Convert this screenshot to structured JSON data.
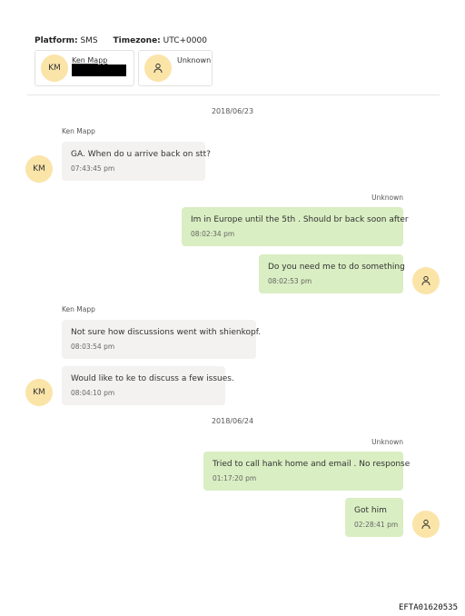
{
  "header": {
    "platform_label": "Platform:",
    "platform_value": "SMS",
    "timezone_label": "Timezone:",
    "timezone_value": "UTC+0000"
  },
  "participants": [
    {
      "initials": "KM",
      "name": "Ken Mapp",
      "redacted": true
    },
    {
      "icon": "person-icon",
      "name": "Unknown"
    }
  ],
  "dates": [
    "2018/06/23",
    "2018/06/24"
  ],
  "messages": [
    {
      "sender": "Ken Mapp",
      "dir": "in",
      "text": "GA. When do u arrive back on stt?",
      "time": "07:43:45 pm"
    },
    {
      "sender": "Unknown",
      "dir": "out",
      "text": "Im in Europe until the 5th .   Should br back soon after",
      "time": "08:02:34 pm"
    },
    {
      "sender": "Unknown",
      "dir": "out",
      "text": "Do you need me to do something",
      "time": "08:02:53 pm"
    },
    {
      "sender": "Ken Mapp",
      "dir": "in",
      "text": "Not sure how discussions went with shienkopf.",
      "time": "08:03:54 pm"
    },
    {
      "sender": "Ken Mapp",
      "dir": "in",
      "text": "Would like to ke to discuss a few issues.",
      "time": "08:04:10 pm"
    },
    {
      "sender": "Unknown",
      "dir": "out",
      "text": "Tried to call hank home and email . No response",
      "time": "01:17:20 pm"
    },
    {
      "sender": "Unknown",
      "dir": "out",
      "text": "Got him",
      "time": "02:28:41 pm"
    }
  ],
  "footer_id": "EFTA01620535",
  "colors": {
    "incoming_bubble": "#f3f2f0",
    "outgoing_bubble": "#d9eec2",
    "avatar": "#fbe4a8"
  }
}
